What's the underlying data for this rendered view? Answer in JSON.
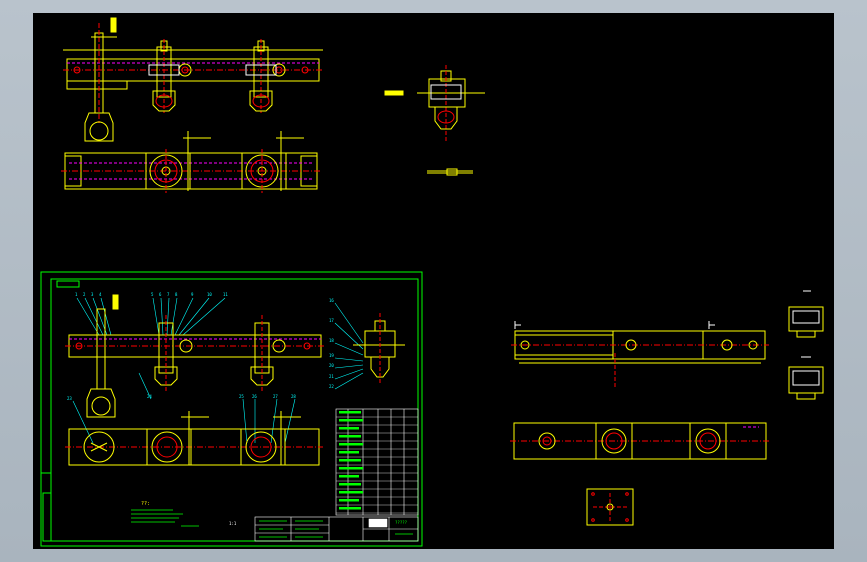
{
  "colors": {
    "background": "#000000",
    "frame": "#a9b4be",
    "outline": "#ffff00",
    "centerline": "#ff0000",
    "border": "#00ff00",
    "detail": "#ffffff",
    "accent": "#ff00ff",
    "hidden": "#00ffff"
  },
  "drawing": {
    "title_block_label": "?????",
    "part_numbers_left": [
      "1",
      "2",
      "3",
      "4",
      "5",
      "6",
      "7",
      "8",
      "9",
      "10",
      "11",
      "12",
      "13",
      "14",
      "15"
    ],
    "part_numbers_right": [
      "16",
      "17",
      "18",
      "19",
      "20",
      "21",
      "22"
    ],
    "bottom_part_numbers": [
      "23",
      "24",
      "25",
      "26",
      "27",
      "28"
    ],
    "notes_heading": "??:",
    "scale_text": "1:1"
  }
}
